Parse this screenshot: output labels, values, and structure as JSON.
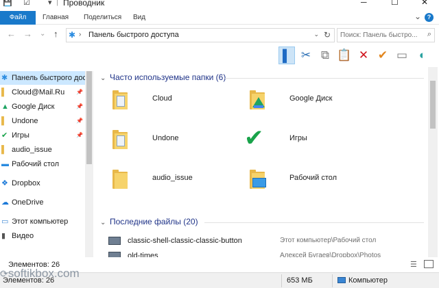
{
  "window": {
    "title": "Проводник",
    "qa_save": "💾",
    "qa_check": "☑",
    "qa_arrow": "▾",
    "qa_bar": "|",
    "minimize": "─",
    "maximize": "☐",
    "close": "✕"
  },
  "ribbon": {
    "tabs": [
      "Файл",
      "Главная",
      "Поделиться",
      "Вид"
    ],
    "collapse": "⌄",
    "help": "?"
  },
  "address": {
    "back": "←",
    "forward": "→",
    "recent": "⌄",
    "up": "↑",
    "pin_icon": "✱",
    "sep": "›",
    "path": "Панель быстрого доступа",
    "dropdown": "⌄",
    "refresh": "↻",
    "search_placeholder": "Поиск: Панель быстро...",
    "search_icon": "⌕"
  },
  "toolbar": {
    "buttons": [
      {
        "name": "layout-pane-button",
        "glyph": "▌",
        "color": "#1f6bc4",
        "active": true
      },
      {
        "name": "cut-button",
        "glyph": "✂",
        "color": "#2b6fb5",
        "active": false
      },
      {
        "name": "copy-button",
        "glyph": "⧉",
        "color": "#7a7a7a",
        "active": false
      },
      {
        "name": "paste-button",
        "glyph": "📋",
        "color": "#7a7a7a",
        "active": false
      },
      {
        "name": "delete-button",
        "glyph": "✕",
        "color": "#d0121b",
        "active": false
      },
      {
        "name": "select-check-button",
        "glyph": "✔",
        "color": "#e2861e",
        "active": false
      },
      {
        "name": "properties-button",
        "glyph": "▭",
        "color": "#7a7a7a",
        "active": false
      },
      {
        "name": "settings-button",
        "glyph": "◐",
        "color": "#2aa2a0",
        "active": false
      }
    ]
  },
  "nav": {
    "items": [
      {
        "label": "Панель быстрого доступа",
        "icon": "✱",
        "icon_color": "#2a8be0",
        "pinned": false,
        "selected": true
      },
      {
        "label": "Cloud@Mail.Ru",
        "icon": "▌",
        "icon_color": "#e8b84a",
        "pinned": true,
        "selected": false
      },
      {
        "label": "Google Диск",
        "icon": "▲",
        "icon_color": "#1fa463",
        "pinned": true,
        "selected": false
      },
      {
        "label": "Undone",
        "icon": "▌",
        "icon_color": "#e8b84a",
        "pinned": true,
        "selected": false
      },
      {
        "label": "Игры",
        "icon": "✔",
        "icon_color": "#19a34a",
        "pinned": true,
        "selected": false
      },
      {
        "label": "audio_issue",
        "icon": "▌",
        "icon_color": "#e8b84a",
        "pinned": false,
        "selected": false
      },
      {
        "label": "Рабочий стол",
        "icon": "▬",
        "icon_color": "#2a8be0",
        "pinned": false,
        "selected": false
      },
      {
        "label": "Dropbox",
        "icon": "❖",
        "icon_color": "#1b79d8",
        "pinned": false,
        "selected": false
      },
      {
        "label": "OneDrive",
        "icon": "☁",
        "icon_color": "#1b79d8",
        "pinned": false,
        "selected": false
      },
      {
        "label": "Этот компьютер",
        "icon": "▭",
        "icon_color": "#3a86d4",
        "pinned": false,
        "selected": false
      },
      {
        "label": "Видео",
        "icon": "▮",
        "icon_color": "#555555",
        "pinned": false,
        "selected": false
      }
    ],
    "pin_glyph": "📌"
  },
  "content": {
    "frequent_header": "Часто используемые папки (6)",
    "recent_header": "Последние файлы (20)",
    "chevron": "⌄",
    "folders": [
      {
        "name": "Cloud",
        "overlay": "doc"
      },
      {
        "name": "Google Диск",
        "overlay": "gdrive"
      },
      {
        "name": "Undone",
        "overlay": "doc"
      },
      {
        "name": "Игры",
        "overlay": "check"
      },
      {
        "name": "audio_issue",
        "overlay": "none"
      },
      {
        "name": "Рабочий стол",
        "overlay": "desktop"
      }
    ],
    "recent": [
      {
        "name": "classic-shell-classic-classic-button",
        "path": "Этот компьютер\\Рабочий стол"
      },
      {
        "name": "old-times",
        "path": "Алексей Бугаев\\Dropbox\\Photos"
      }
    ]
  },
  "status": {
    "count": "Элементов: 26",
    "bar_count": "Элементов: 26",
    "size": "653 МБ",
    "computer": "Компьютер",
    "view_list": "☰"
  },
  "watermark": {
    "text": "softikbox.com",
    "icon": "⟳"
  }
}
